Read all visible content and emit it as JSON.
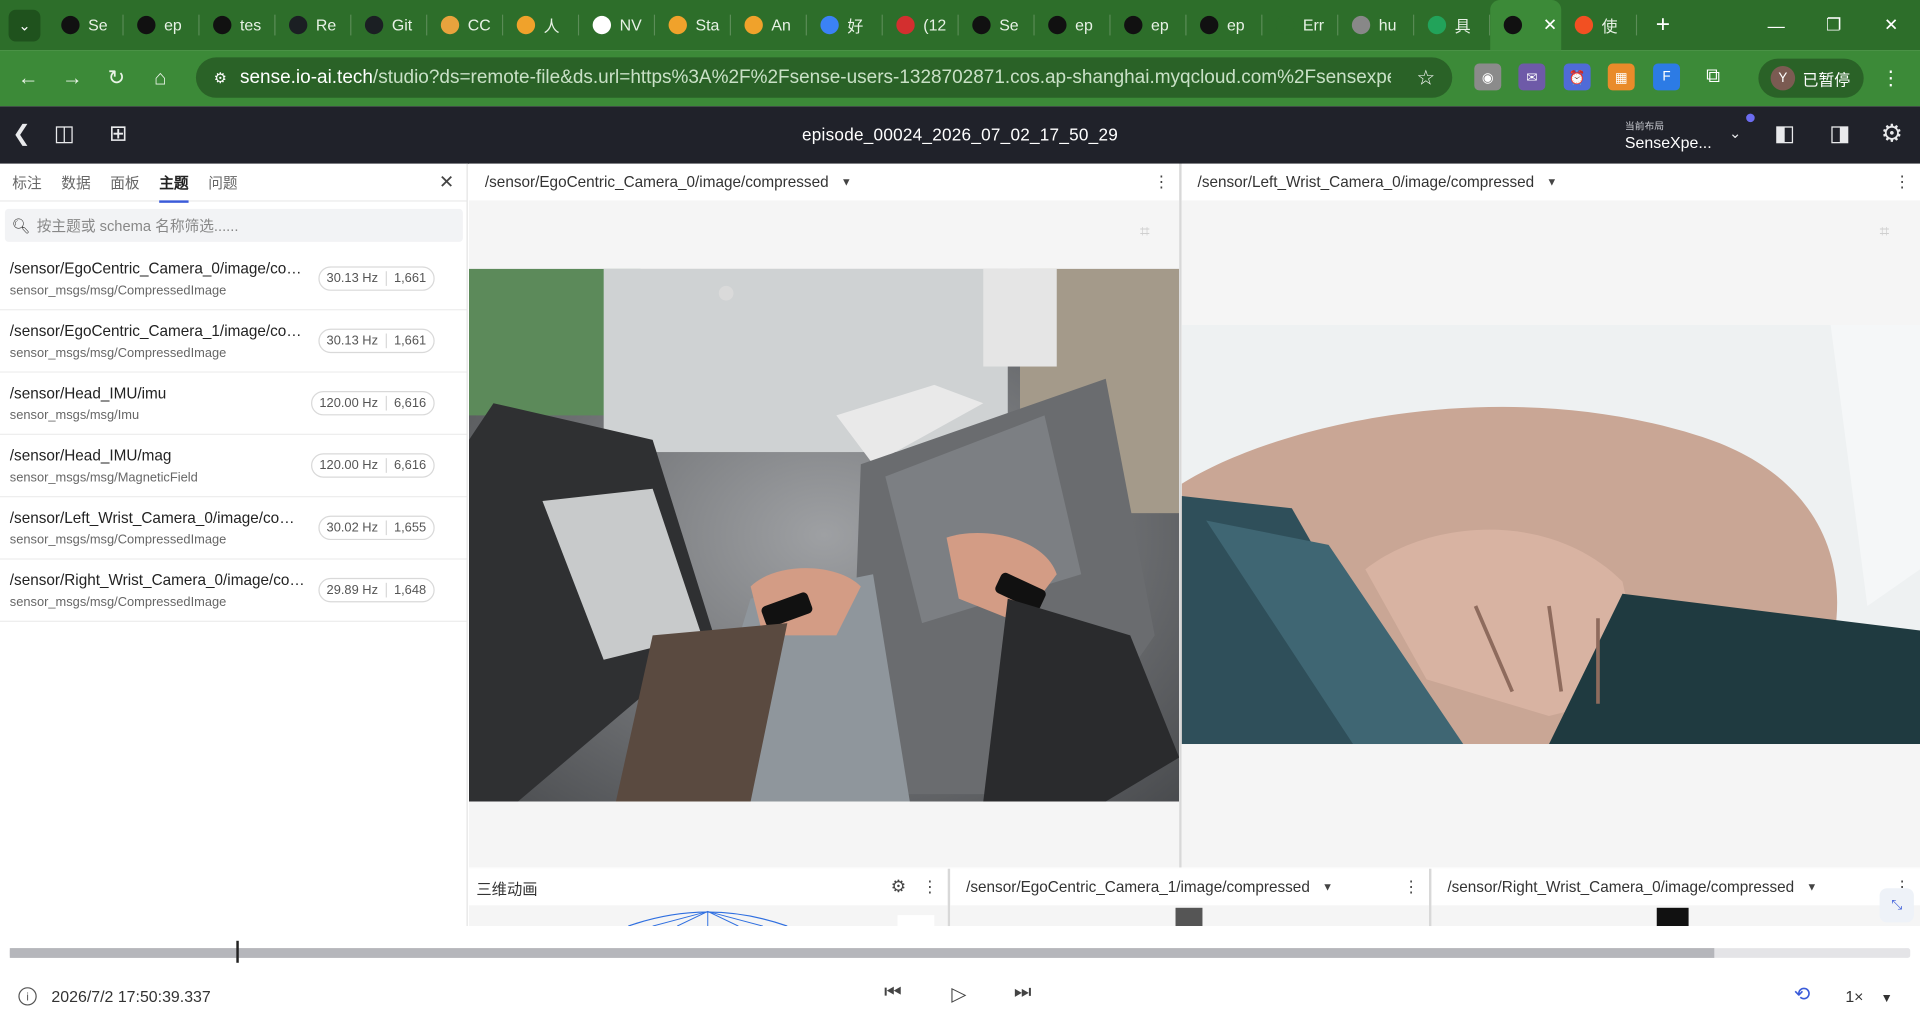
{
  "browser": {
    "tabs": [
      {
        "label": "Se",
        "icon": "openai-icon",
        "color": "#111111"
      },
      {
        "label": "ep",
        "icon": "openai-icon",
        "color": "#111111"
      },
      {
        "label": "tes",
        "icon": "openai-icon",
        "color": "#111111"
      },
      {
        "label": "Re",
        "icon": "github-icon",
        "color": "#1b1f23"
      },
      {
        "label": "Git",
        "icon": "github-icon",
        "color": "#1b1f23"
      },
      {
        "label": "CC",
        "icon": "ring-icon",
        "color": "#e8a33d"
      },
      {
        "label": "人",
        "icon": "app-icon",
        "color": "#f0a22b"
      },
      {
        "label": "NV",
        "icon": "openai-icon",
        "color": "#ffffff"
      },
      {
        "label": "Sta",
        "icon": "hf-icon",
        "color": "#f0a22b"
      },
      {
        "label": "An",
        "icon": "hf-icon",
        "color": "#f0a22b"
      },
      {
        "label": "好",
        "icon": "doc-icon",
        "color": "#3b82f6"
      },
      {
        "label": "(12",
        "icon": "weibo-icon",
        "color": "#d32f2f"
      },
      {
        "label": "Se",
        "icon": "openai-icon",
        "color": "#111111"
      },
      {
        "label": "ep",
        "icon": "openai-icon",
        "color": "#111111"
      },
      {
        "label": "ep",
        "icon": "openai-icon",
        "color": "#111111"
      },
      {
        "label": "ep",
        "icon": "openai-icon",
        "color": "#111111"
      },
      {
        "label": "Err",
        "icon": "pi-icon",
        "color": "#2d6e2a"
      },
      {
        "label": "hu",
        "icon": "globe-icon",
        "color": "#888888"
      },
      {
        "label": "具",
        "icon": "sheet-icon",
        "color": "#22a35a"
      },
      {
        "label": "",
        "icon": "openai-icon",
        "color": "#111111",
        "active": true
      },
      {
        "label": "使",
        "icon": "ms-icon",
        "color": "#f25022"
      }
    ],
    "url_host": "sense.io-ai.tech",
    "url_rest": "/studio?ds=remote-file&ds.url=https%3A%2F%2Fsense-users-1328702871.cos.ap-shanghai.myqcloud.com%2Fsensexpe...",
    "profile_initial": "Y",
    "profile_label": "已暂停"
  },
  "app": {
    "episode_title": "episode_00024_2026_07_02_17_50_29",
    "layout_caption": "当前布局",
    "layout_name": "SenseXpe..."
  },
  "sidebar": {
    "tabs": [
      "标注",
      "数据",
      "面板",
      "主题",
      "问题"
    ],
    "active_tab": "主题",
    "filter_placeholder": "按主题或 schema 名称筛选......",
    "topics": [
      {
        "name": "/sensor/EgoCentric_Camera_0/image/compressed",
        "schema": "sensor_msgs/msg/CompressedImage",
        "hz": "30.13 Hz",
        "count": "1,661"
      },
      {
        "name": "/sensor/EgoCentric_Camera_1/image/compressed",
        "schema": "sensor_msgs/msg/CompressedImage",
        "hz": "30.13 Hz",
        "count": "1,661"
      },
      {
        "name": "/sensor/Head_IMU/imu",
        "schema": "sensor_msgs/msg/Imu",
        "hz": "120.00 Hz",
        "count": "6,616"
      },
      {
        "name": "/sensor/Head_IMU/mag",
        "schema": "sensor_msgs/msg/MagneticField",
        "hz": "120.00 Hz",
        "count": "6,616"
      },
      {
        "name": "/sensor/Left_Wrist_Camera_0/image/compressed",
        "schema": "sensor_msgs/msg/CompressedImage",
        "hz": "30.02 Hz",
        "count": "1,655"
      },
      {
        "name": "/sensor/Right_Wrist_Camera_0/image/compressed",
        "schema": "sensor_msgs/msg/CompressedImage",
        "hz": "29.89 Hz",
        "count": "1,648"
      }
    ]
  },
  "panels": {
    "ego0_title": "/sensor/EgoCentric_Camera_0/image/compressed",
    "left_wrist_title": "/sensor/Left_Wrist_Camera_0/image/compressed",
    "three_d_title": "三维动画",
    "ego1_title": "/sensor/EgoCentric_Camera_1/image/compressed",
    "right_wrist_title": "/sensor/Right_Wrist_Camera_0/image/compressed"
  },
  "playback": {
    "timestamp": "2026/7/2 17:50:39.337",
    "speed": "1×",
    "progress": 0.119,
    "buffered": 0.897
  }
}
